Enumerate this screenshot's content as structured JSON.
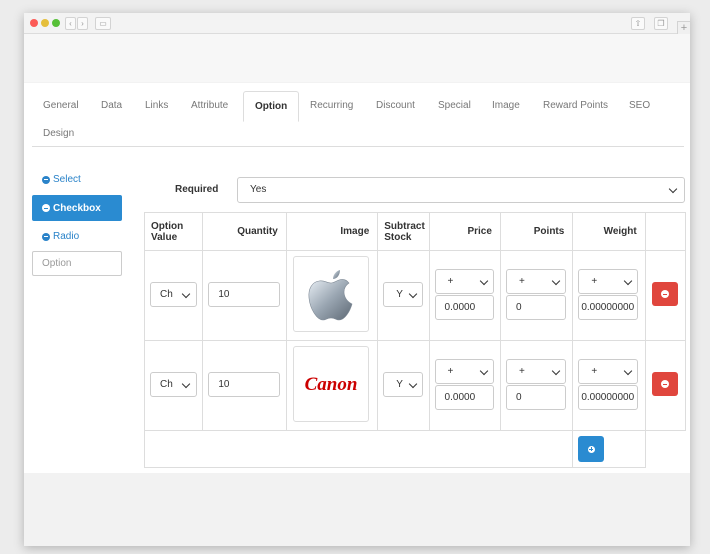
{
  "browser": {
    "controls": [
      "close-dot",
      "minimize-dot",
      "maximize-dot"
    ]
  },
  "tabs": [
    "General",
    "Data",
    "Links",
    "Attribute",
    "Option",
    "Recurring",
    "Discount",
    "Special",
    "Image",
    "Reward Points",
    "SEO",
    "Design"
  ],
  "active_tab": "Option",
  "sidebar": {
    "items": [
      {
        "label": "Select",
        "active": false
      },
      {
        "label": "Checkbox",
        "active": true
      },
      {
        "label": "Radio",
        "active": false
      }
    ],
    "option_placeholder": "Option"
  },
  "required": {
    "label": "Required",
    "value": "Yes"
  },
  "table": {
    "headers": {
      "option_value": "Option Value",
      "quantity": "Quantity",
      "image": "Image",
      "subtract_stock": "Subtract Stock",
      "price": "Price",
      "points": "Points",
      "weight": "Weight"
    },
    "rows": [
      {
        "option_value": "Ch",
        "quantity": "10",
        "image": "Apple logo",
        "subtract": "Y",
        "price_prefix": "+",
        "price": "0.0000",
        "points_prefix": "+",
        "points": "0",
        "weight_prefix": "+",
        "weight": "0.00000000"
      },
      {
        "option_value": "Ch",
        "quantity": "10",
        "image": "Canon",
        "subtract": "Y",
        "price_prefix": "+",
        "price": "0.0000",
        "points_prefix": "+",
        "points": "0",
        "weight_prefix": "+",
        "weight": "0.00000000"
      }
    ]
  },
  "colors": {
    "primary": "#2a8bd1",
    "danger": "#e0463d",
    "canon_red": "#cc0000"
  }
}
